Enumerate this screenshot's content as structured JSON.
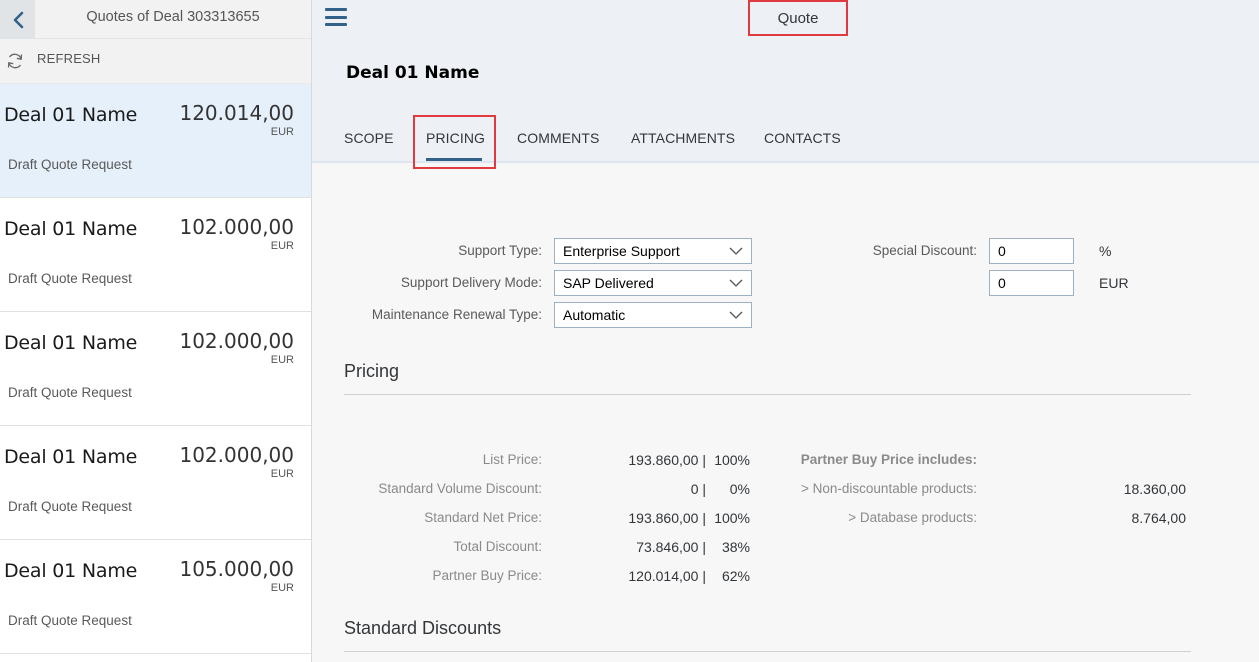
{
  "master": {
    "title": "Quotes of Deal 303313655",
    "refresh_label": "REFRESH",
    "items": [
      {
        "title": "Deal 01 Name",
        "amount": "120.014,00",
        "currency": "EUR",
        "status": "Draft Quote Request"
      },
      {
        "title": "Deal 01 Name",
        "amount": "102.000,00",
        "currency": "EUR",
        "status": "Draft Quote Request"
      },
      {
        "title": "Deal 01 Name",
        "amount": "102.000,00",
        "currency": "EUR",
        "status": "Draft Quote Request"
      },
      {
        "title": "Deal 01 Name",
        "amount": "102.000,00",
        "currency": "EUR",
        "status": "Draft Quote Request"
      },
      {
        "title": "Deal 01 Name",
        "amount": "105.000,00",
        "currency": "EUR",
        "status": "Draft Quote Request"
      }
    ]
  },
  "detail": {
    "page_title": "Quote",
    "object_title": "Deal 01 Name",
    "tabs": [
      "SCOPE",
      "PRICING",
      "COMMENTS",
      "ATTACHMENTS",
      "CONTACTS"
    ],
    "active_tab": "PRICING",
    "form": {
      "support_type_label": "Support Type:",
      "support_type_value": "Enterprise Support",
      "delivery_mode_label": "Support Delivery Mode:",
      "delivery_mode_value": "SAP Delivered",
      "renewal_type_label": "Maintenance Renewal Type:",
      "renewal_type_value": "Automatic",
      "special_discount_label": "Special Discount:",
      "special_discount_pct": "0",
      "special_discount_pct_unit": "%",
      "special_discount_amount": "0",
      "special_discount_amount_unit": "EUR"
    },
    "pricing": {
      "section_title": "Pricing",
      "rows": [
        {
          "label": "List Price:",
          "value": "193.860,00 |",
          "pct": "100%"
        },
        {
          "label": "Standard Volume Discount:",
          "value": "0 |",
          "pct": "0%"
        },
        {
          "label": "Standard Net Price:",
          "value": "193.860,00 |",
          "pct": "100%"
        },
        {
          "label": "Total Discount:",
          "value": "73.846,00 |",
          "pct": "38%"
        },
        {
          "label": "Partner Buy Price:",
          "value": "120.014,00 |",
          "pct": "62%"
        }
      ],
      "includes_title": "Partner Buy Price includes:",
      "includes": [
        {
          "label": "> Non-discountable products:",
          "value": "18.360,00"
        },
        {
          "label": "> Database products:",
          "value": "8.764,00"
        }
      ]
    },
    "standard_discounts_title": "Standard Discounts"
  },
  "colors": {
    "accent": "#346187",
    "highlight_border": "#e0393e",
    "selected_item_bg": "#e5f0fa",
    "header_bg": "#edf1f6"
  },
  "icons": {
    "back": "chevron-left-icon",
    "refresh": "refresh-icon",
    "menu": "hamburger-menu-icon",
    "dropdown": "chevron-down-icon"
  }
}
